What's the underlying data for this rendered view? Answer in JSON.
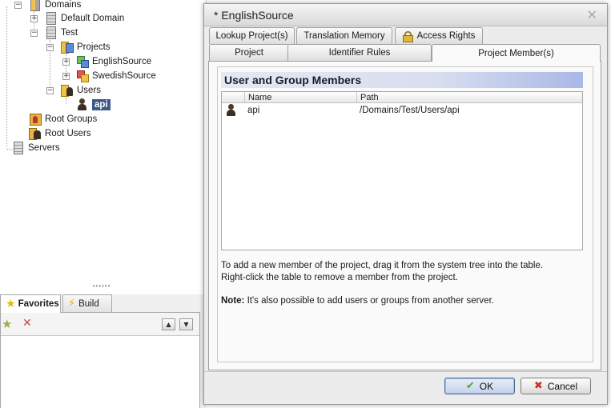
{
  "tree": {
    "items": [
      {
        "label": "Domains",
        "icon": "domains-icon"
      },
      {
        "label": "Default Domain",
        "icon": "server-icon"
      },
      {
        "label": "Test",
        "icon": "server-icon"
      },
      {
        "label": "Projects",
        "icon": "projects-icon"
      },
      {
        "label": "EnglishSource",
        "icon": "project-icon"
      },
      {
        "label": "SwedishSource",
        "icon": "project-icon"
      },
      {
        "label": "Users",
        "icon": "users-folder-icon"
      },
      {
        "label": "api",
        "icon": "user-icon",
        "selected": true
      },
      {
        "label": "Root Groups",
        "icon": "root-groups-icon"
      },
      {
        "label": "Root Users",
        "icon": "root-users-icon"
      },
      {
        "label": "Servers",
        "icon": "servers-icon"
      }
    ]
  },
  "splitter": {
    "grip": "••••••"
  },
  "bottom_panel": {
    "tabs": [
      {
        "label": "Favorites",
        "icon": "star-icon",
        "active": true
      },
      {
        "label": "Build",
        "icon": "lightning-icon",
        "active": false
      }
    ]
  },
  "dialog": {
    "title": "* EnglishSource",
    "close_glyph": "✕",
    "tabs_row1": [
      {
        "label": "Lookup Project(s)"
      },
      {
        "label": "Translation Memory"
      },
      {
        "label": "Access Rights",
        "icon": "lock-icon"
      }
    ],
    "tabs_row2": [
      {
        "label": "Project"
      },
      {
        "label": "Identifier Rules"
      },
      {
        "label": "Project Member(s)",
        "active": true
      }
    ],
    "section_title": "User and Group Members",
    "table": {
      "columns": [
        "Name",
        "Path"
      ],
      "rows": [
        {
          "icon": "user-icon",
          "name": "api",
          "path": "/Domains/Test/Users/api"
        }
      ]
    },
    "help": {
      "line1": "To add a new member of the project, drag it from the system tree into the table.",
      "line2": "Right-click the table to remove a member from the project.",
      "note_label": "Note:",
      "note_text": " It's also possible to add users or groups from another server."
    },
    "buttons": {
      "ok": "OK",
      "cancel": "Cancel"
    }
  },
  "colors": {
    "selection": "#3b5b86",
    "header_gradient_end": "#a9b8e6",
    "ok_icon": "#4aa63a",
    "cancel_icon": "#cc2f2a"
  }
}
